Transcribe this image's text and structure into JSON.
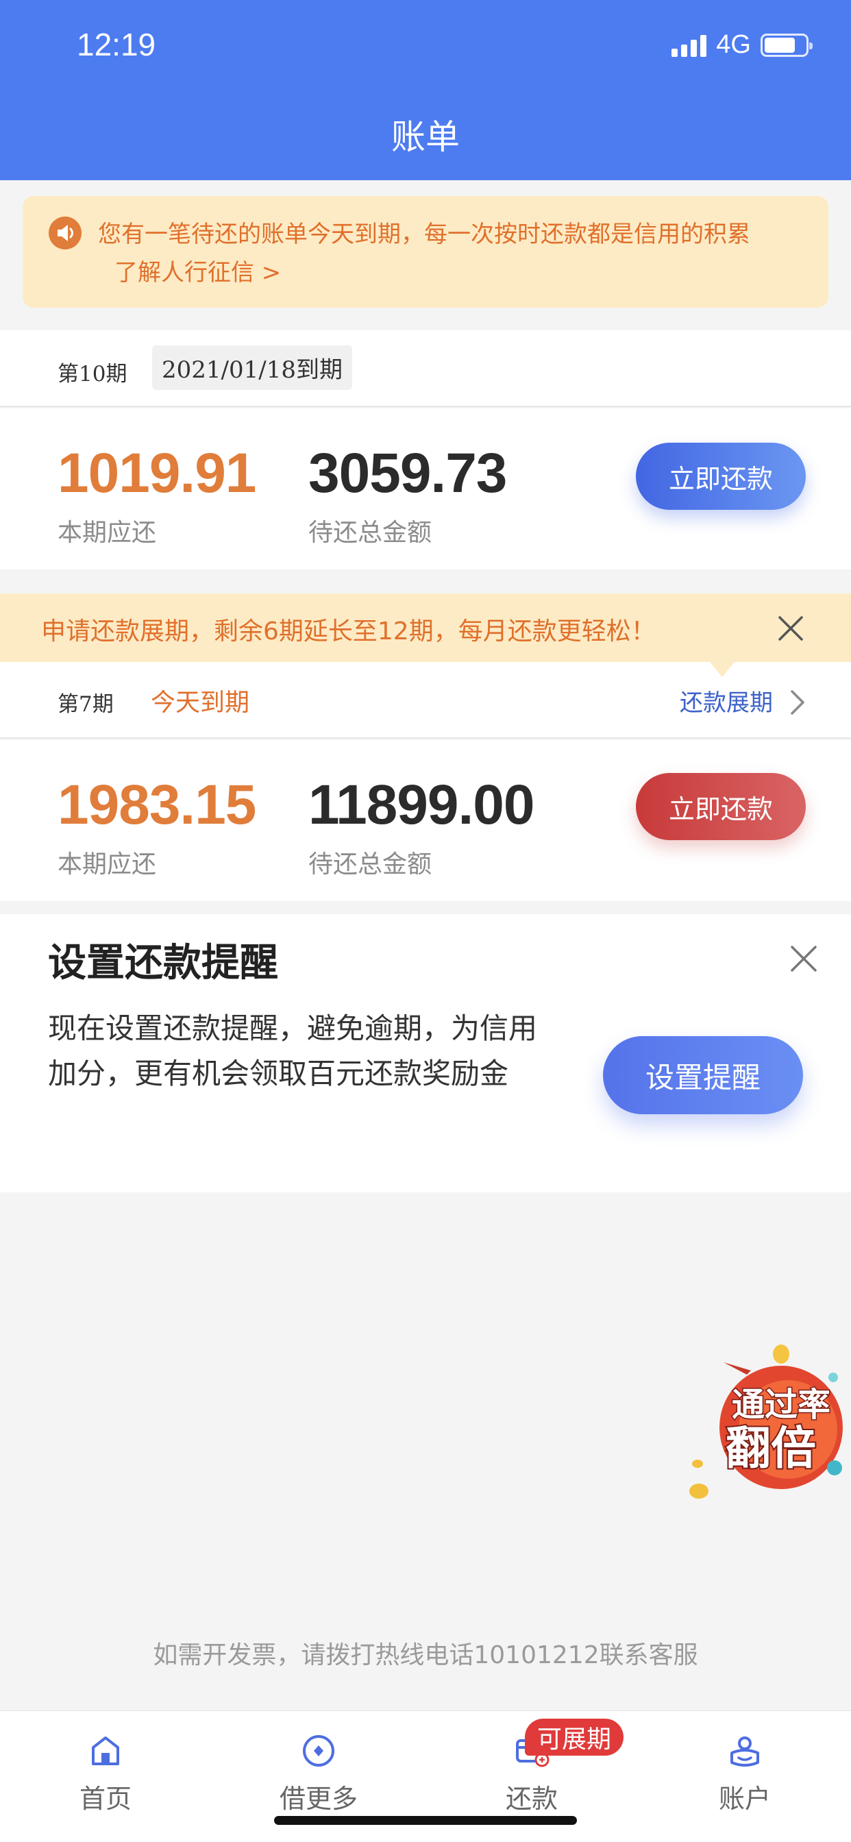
{
  "status_bar": {
    "time": "12:19",
    "network": "4G"
  },
  "header": {
    "title": "账单"
  },
  "notice": {
    "line1": "您有一笔待还的账单今天到期，每一次按时还款都是信用的积累",
    "line2": "了解人行征信 >",
    "icon": "speaker-icon"
  },
  "bill_1": {
    "period": "第10期",
    "due_date": "2021/01/18到期",
    "amount_now": "1019.91",
    "amount_now_label": "本期应还",
    "amount_total": "3059.73",
    "amount_total_label": "待还总金额",
    "pay_button": "立即还款",
    "accent_color": "#4d7cf1"
  },
  "extension_banner": {
    "text": "申请还款展期，剩余6期延长至12期，每月还款更轻松！"
  },
  "bill_2": {
    "period": "第7期",
    "due_status": "今天到期",
    "extension_link": "还款展期",
    "amount_now": "1983.15",
    "amount_now_label": "本期应还",
    "amount_total": "11899.00",
    "amount_total_label": "待还总金额",
    "pay_button": "立即还款",
    "accent_color": "#c83a3a"
  },
  "reminder": {
    "title": "设置还款提醒",
    "description": "现在设置还款提醒，避免逾期，为信用加分，更有机会领取百元还款奖励金",
    "button": "设置提醒"
  },
  "promo_badge": {
    "line1": "通过率",
    "line2": "翻倍"
  },
  "footer_note": "如需开发票，请拨打热线电话10101212联系客服",
  "tabbar": {
    "items": [
      {
        "label": "首页",
        "icon": "home-icon"
      },
      {
        "label": "借更多",
        "icon": "diamond-icon"
      },
      {
        "label": "还款",
        "icon": "repay-card-icon"
      },
      {
        "label": "账户",
        "icon": "user-icon"
      }
    ],
    "badge": "可展期"
  }
}
